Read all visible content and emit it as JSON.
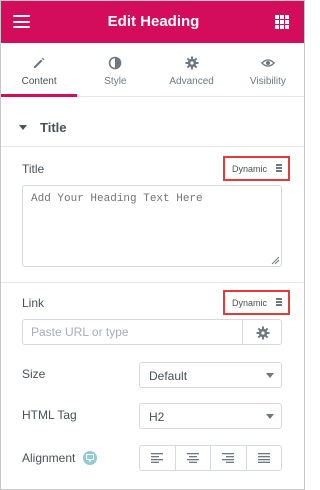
{
  "header": {
    "title": "Edit Heading",
    "menu_icon": "hamburger-icon",
    "widgets_icon": "grid-icon"
  },
  "tabs": [
    {
      "label": "Content",
      "icon": "pencil-icon",
      "active": true
    },
    {
      "label": "Style",
      "icon": "half-circle-icon",
      "active": false
    },
    {
      "label": "Advanced",
      "icon": "gear-icon",
      "active": false
    },
    {
      "label": "Visibility",
      "icon": "eye-icon",
      "active": false
    }
  ],
  "section": {
    "title": "Title",
    "icon": "caret-down-icon"
  },
  "title_field": {
    "label": "Title",
    "dynamic_label": "Dynamic",
    "placeholder": "Add Your Heading Text Here",
    "value": ""
  },
  "link_field": {
    "label": "Link",
    "dynamic_label": "Dynamic",
    "placeholder": "Paste URL or type",
    "value": ""
  },
  "size_field": {
    "label": "Size",
    "value": "Default"
  },
  "html_tag_field": {
    "label": "HTML Tag",
    "value": "H2"
  },
  "alignment_field": {
    "label": "Alignment",
    "device_icon": "monitor-icon",
    "options": [
      "align-left-icon",
      "align-center-icon",
      "align-right-icon",
      "align-justify-icon"
    ]
  },
  "colors": {
    "brand": "#d30c5c",
    "highlight_border": "#e33a3a",
    "device_badge": "#93c9d8"
  }
}
